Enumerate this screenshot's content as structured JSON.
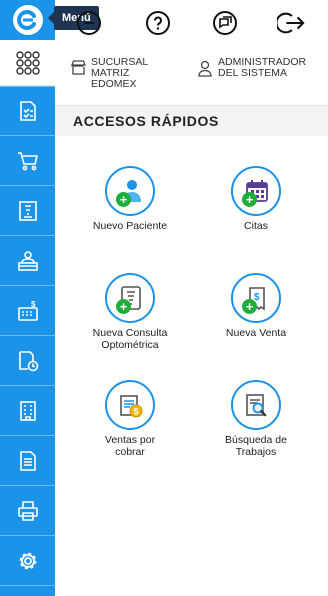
{
  "sidebar": {
    "menu_tooltip": "Menú",
    "nav_icons": [
      "checklist-icon",
      "cart-icon",
      "eye-chart-icon",
      "reception-icon",
      "cash-register-icon",
      "clock-document-icon",
      "building-icon",
      "document-icon",
      "printer-icon",
      "settings-icon"
    ]
  },
  "header": {
    "branch_line1": "SUCURSAL",
    "branch_line2": "MATRIZ",
    "branch_line3": "EDOMEX",
    "user_line1": "ADMINISTRADOR",
    "user_line2": "DEL SISTEMA"
  },
  "section": {
    "title": "ACCESOS RÁPIDOS"
  },
  "quick_access": {
    "nuevo_paciente": "Nuevo Paciente",
    "citas": "Citas",
    "consulta_line1": "Nueva Consulta",
    "consulta_line2": "Optométrica",
    "nueva_venta": "Nueva Venta",
    "ventas_line1": "Ventas por",
    "ventas_line2": "cobrar",
    "busqueda_line1": "Búsqueda de",
    "busqueda_line2": "Trabajos"
  },
  "colors": {
    "primary": "#1a93e8",
    "tooltip": "#1f3450",
    "plus": "#1fae3a"
  }
}
